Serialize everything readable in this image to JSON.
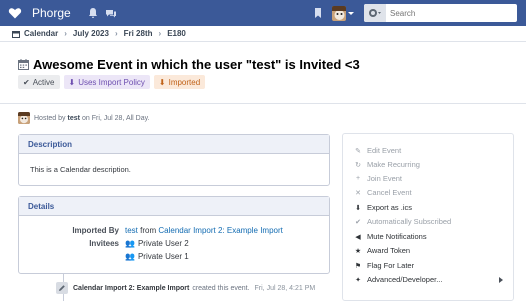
{
  "topbar": {
    "app_name": "Phorge",
    "search_placeholder": "Search",
    "icons": [
      "heart-logo-icon",
      "bell-icon",
      "chat-icon",
      "bookmark-icon",
      "avatar",
      "scope-icon"
    ],
    "colors": {
      "bar": "#3b5998"
    }
  },
  "breadcrumb": {
    "items": [
      "Calendar",
      "July 2023",
      "Fri 28th",
      "E180"
    ]
  },
  "header": {
    "title": "Awesome Event in which the user \"test\" is Invited <3",
    "tags": [
      {
        "label": "Active",
        "icon": "check-icon",
        "color": "#4a5059"
      },
      {
        "label": "Uses Import Policy",
        "icon": "download-icon",
        "color": "#6e4fb0"
      },
      {
        "label": "Imported",
        "icon": "download-icon",
        "color": "#c06219"
      }
    ]
  },
  "host": {
    "prefix": "Hosted by",
    "user": "test",
    "suffix": "on Fri, Jul 28, All Day."
  },
  "description": {
    "heading": "Description",
    "text": "This is a Calendar description."
  },
  "details": {
    "heading": "Details",
    "imported_by_label": "Imported By",
    "imported_by_user": "test",
    "imported_from_text": "from",
    "imported_source": "Calendar Import 2: Example Import",
    "invitees_label": "Invitees",
    "invitees": [
      "Private User 2",
      "Private User 1"
    ]
  },
  "timeline": {
    "actor": "Calendar Import 2: Example Import",
    "action": "created this event.",
    "time": "Fri, Jul 28, 4:21 PM"
  },
  "actions": [
    {
      "label": "Edit Event",
      "icon": "pencil-icon",
      "enabled": false
    },
    {
      "label": "Make Recurring",
      "icon": "repeat-icon",
      "enabled": false
    },
    {
      "label": "Join Event",
      "icon": "plus-icon",
      "enabled": false
    },
    {
      "label": "Cancel Event",
      "icon": "times-icon",
      "enabled": false
    },
    {
      "label": "Export as .ics",
      "icon": "download-icon",
      "enabled": true
    },
    {
      "label": "Automatically Subscribed",
      "icon": "check-circle-icon",
      "enabled": false
    },
    {
      "label": "Mute Notifications",
      "icon": "volume-icon",
      "enabled": true
    },
    {
      "label": "Award Token",
      "icon": "trophy-icon",
      "enabled": true
    },
    {
      "label": "Flag For Later",
      "icon": "flag-icon",
      "enabled": true
    },
    {
      "label": "Advanced/Developer...",
      "icon": "magic-icon",
      "enabled": true
    }
  ]
}
